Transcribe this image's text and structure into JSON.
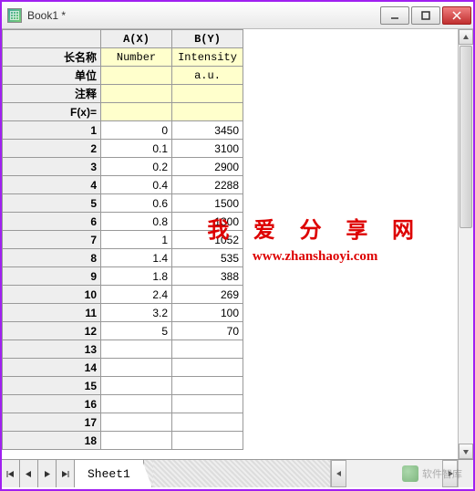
{
  "window": {
    "title": "Book1 *"
  },
  "columns": [
    {
      "header": "A(X)",
      "longname": "Number",
      "units": "",
      "comment": "",
      "fx": ""
    },
    {
      "header": "B(Y)",
      "longname": "Intensity",
      "units": "a.u.",
      "comment": "",
      "fx": ""
    }
  ],
  "meta_row_labels": {
    "longname": "长名称",
    "units": "单位",
    "comment": "注释",
    "fx": "F(x)="
  },
  "rows": [
    {
      "n": 1,
      "a": "0",
      "b": "3450"
    },
    {
      "n": 2,
      "a": "0.1",
      "b": "3100"
    },
    {
      "n": 3,
      "a": "0.2",
      "b": "2900"
    },
    {
      "n": 4,
      "a": "0.4",
      "b": "2288"
    },
    {
      "n": 5,
      "a": "0.6",
      "b": "1500"
    },
    {
      "n": 6,
      "a": "0.8",
      "b": "1300"
    },
    {
      "n": 7,
      "a": "1",
      "b": "1052"
    },
    {
      "n": 8,
      "a": "1.4",
      "b": "535"
    },
    {
      "n": 9,
      "a": "1.8",
      "b": "388"
    },
    {
      "n": 10,
      "a": "2.4",
      "b": "269"
    },
    {
      "n": 11,
      "a": "3.2",
      "b": "100"
    },
    {
      "n": 12,
      "a": "5",
      "b": "70"
    },
    {
      "n": 13,
      "a": "",
      "b": ""
    },
    {
      "n": 14,
      "a": "",
      "b": ""
    },
    {
      "n": 15,
      "a": "",
      "b": ""
    },
    {
      "n": 16,
      "a": "",
      "b": ""
    },
    {
      "n": 17,
      "a": "",
      "b": ""
    },
    {
      "n": 18,
      "a": "",
      "b": ""
    }
  ],
  "sheet": {
    "name": "Sheet1"
  },
  "overlay": {
    "line1": "我 爱 分 享 网",
    "line2": "www.zhanshaoyi.com"
  },
  "watermark": {
    "text": "软件智库"
  },
  "chart_data": {
    "type": "table",
    "title": "Book1",
    "columns": [
      "Number",
      "Intensity (a.u.)"
    ],
    "x": [
      0,
      0.1,
      0.2,
      0.4,
      0.6,
      0.8,
      1,
      1.4,
      1.8,
      2.4,
      3.2,
      5
    ],
    "y": [
      3450,
      3100,
      2900,
      2288,
      1500,
      1300,
      1052,
      535,
      388,
      269,
      100,
      70
    ]
  }
}
